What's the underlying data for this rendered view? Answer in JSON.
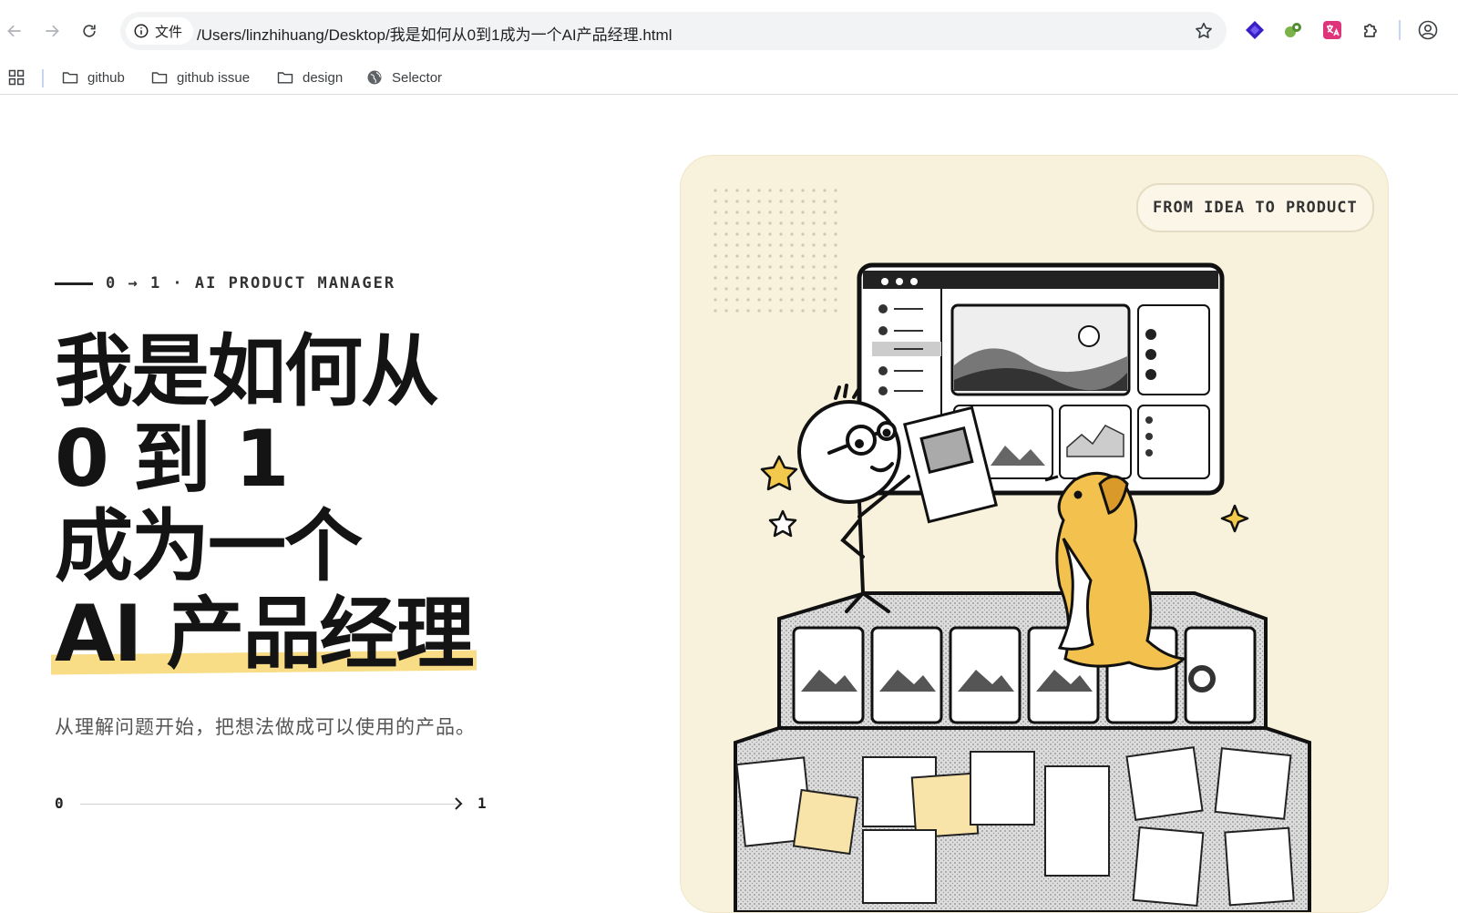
{
  "browser": {
    "site_chip_label": "文件",
    "url": "/Users/linzhihuang/Desktop/我是如何从0到1成为一个AI产品经理.html",
    "bookmarks": [
      {
        "label": "github",
        "icon": "folder-icon"
      },
      {
        "label": "github issue",
        "icon": "folder-icon"
      },
      {
        "label": "design",
        "icon": "folder-icon"
      },
      {
        "label": "Selector",
        "icon": "globe-icon"
      }
    ],
    "extensions": [
      "diamond-extension-icon",
      "puzzle-frog-extension-icon",
      "translate-extension-icon",
      "extensions-puzzle-icon"
    ]
  },
  "hero": {
    "kicker": "0 → 1 · AI PRODUCT MANAGER",
    "title_lines": [
      "我是如何从",
      "0 到 1",
      "成为一个",
      "AI 产品经理"
    ],
    "subtitle": "从理解问题开始，把想法做成可以使用的产品。",
    "progress": {
      "start": "0",
      "end": "1",
      "value": 0.0
    }
  },
  "illustration": {
    "badge": "FROM IDEA TO PRODUCT",
    "accent": "#f9dc86",
    "card_bg": "#f8f1db"
  }
}
